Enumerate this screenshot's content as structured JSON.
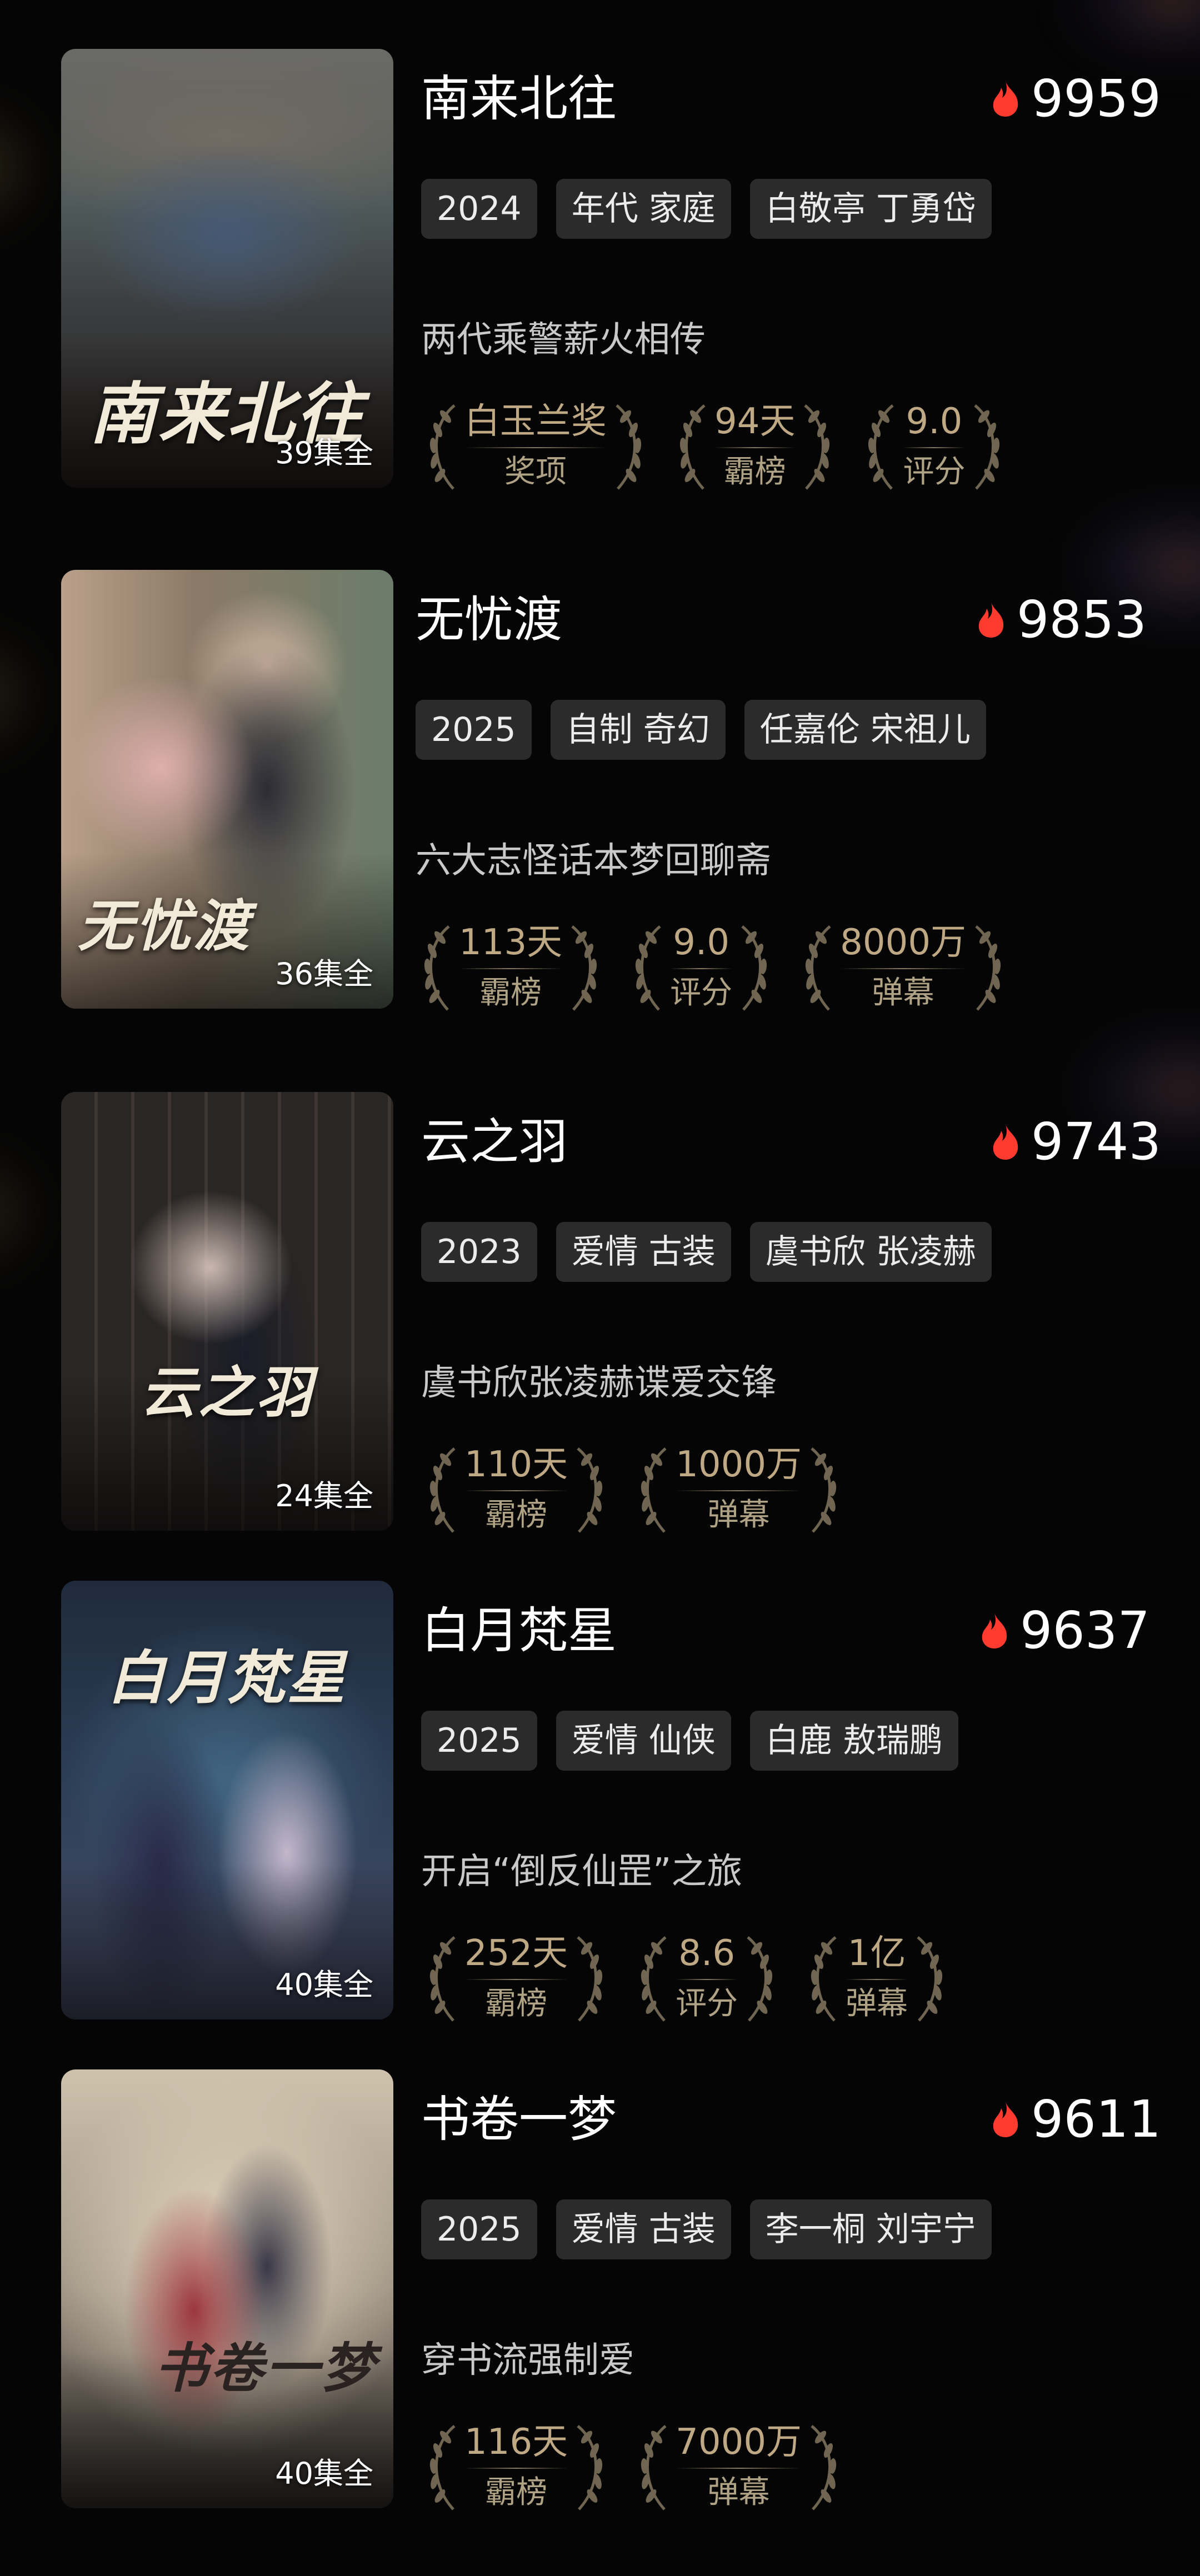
{
  "shows": [
    {
      "title": "南来北往",
      "heat": "9959",
      "episodes": "39集全",
      "poster_logo": "南来北往",
      "tags": [
        "2024",
        "年代 家庭",
        "白敬亭 丁勇岱"
      ],
      "tagline": "两代乘警薪火相传",
      "badges": [
        {
          "value": "白玉兰奖",
          "label": "奖项"
        },
        {
          "value": "94天",
          "label": "霸榜"
        },
        {
          "value": "9.0",
          "label": "评分"
        }
      ]
    },
    {
      "title": "无忧渡",
      "heat": "9853",
      "episodes": "36集全",
      "poster_logo": "无忧渡",
      "tags": [
        "2025",
        "自制 奇幻",
        "任嘉伦 宋祖儿"
      ],
      "tagline": "六大志怪话本梦回聊斋",
      "badges": [
        {
          "value": "113天",
          "label": "霸榜"
        },
        {
          "value": "9.0",
          "label": "评分"
        },
        {
          "value": "8000万",
          "label": "弹幕"
        }
      ]
    },
    {
      "title": "云之羽",
      "heat": "9743",
      "episodes": "24集全",
      "poster_logo": "云之羽",
      "tags": [
        "2023",
        "爱情 古装",
        "虞书欣 张凌赫"
      ],
      "tagline": "虞书欣张凌赫谍爱交锋",
      "badges": [
        {
          "value": "110天",
          "label": "霸榜"
        },
        {
          "value": "1000万",
          "label": "弹幕"
        }
      ]
    },
    {
      "title": "白月梵星",
      "heat": "9637",
      "episodes": "40集全",
      "poster_logo": "白月梵星",
      "tags": [
        "2025",
        "爱情 仙侠",
        "白鹿 敖瑞鹏"
      ],
      "tagline": "开启“倒反仙罡”之旅",
      "badges": [
        {
          "value": "252天",
          "label": "霸榜"
        },
        {
          "value": "8.6",
          "label": "评分"
        },
        {
          "value": "1亿",
          "label": "弹幕"
        }
      ]
    },
    {
      "title": "书卷一梦",
      "heat": "9611",
      "episodes": "40集全",
      "poster_logo": "书卷一梦",
      "tags": [
        "2025",
        "爱情 古装",
        "李一桐 刘宇宁"
      ],
      "tagline": "穿书流强制爱",
      "badges": [
        {
          "value": "116天",
          "label": "霸榜"
        },
        {
          "value": "7000万",
          "label": "弹幕"
        }
      ]
    }
  ],
  "icons": {
    "heat": "flame-icon",
    "badge_frame": "laurel-wreath-icon"
  },
  "colors": {
    "background": "#050505",
    "tag_bg": "#2b2b2b",
    "flame": "#ff3b2f",
    "badge_gold": "#bfa985"
  }
}
